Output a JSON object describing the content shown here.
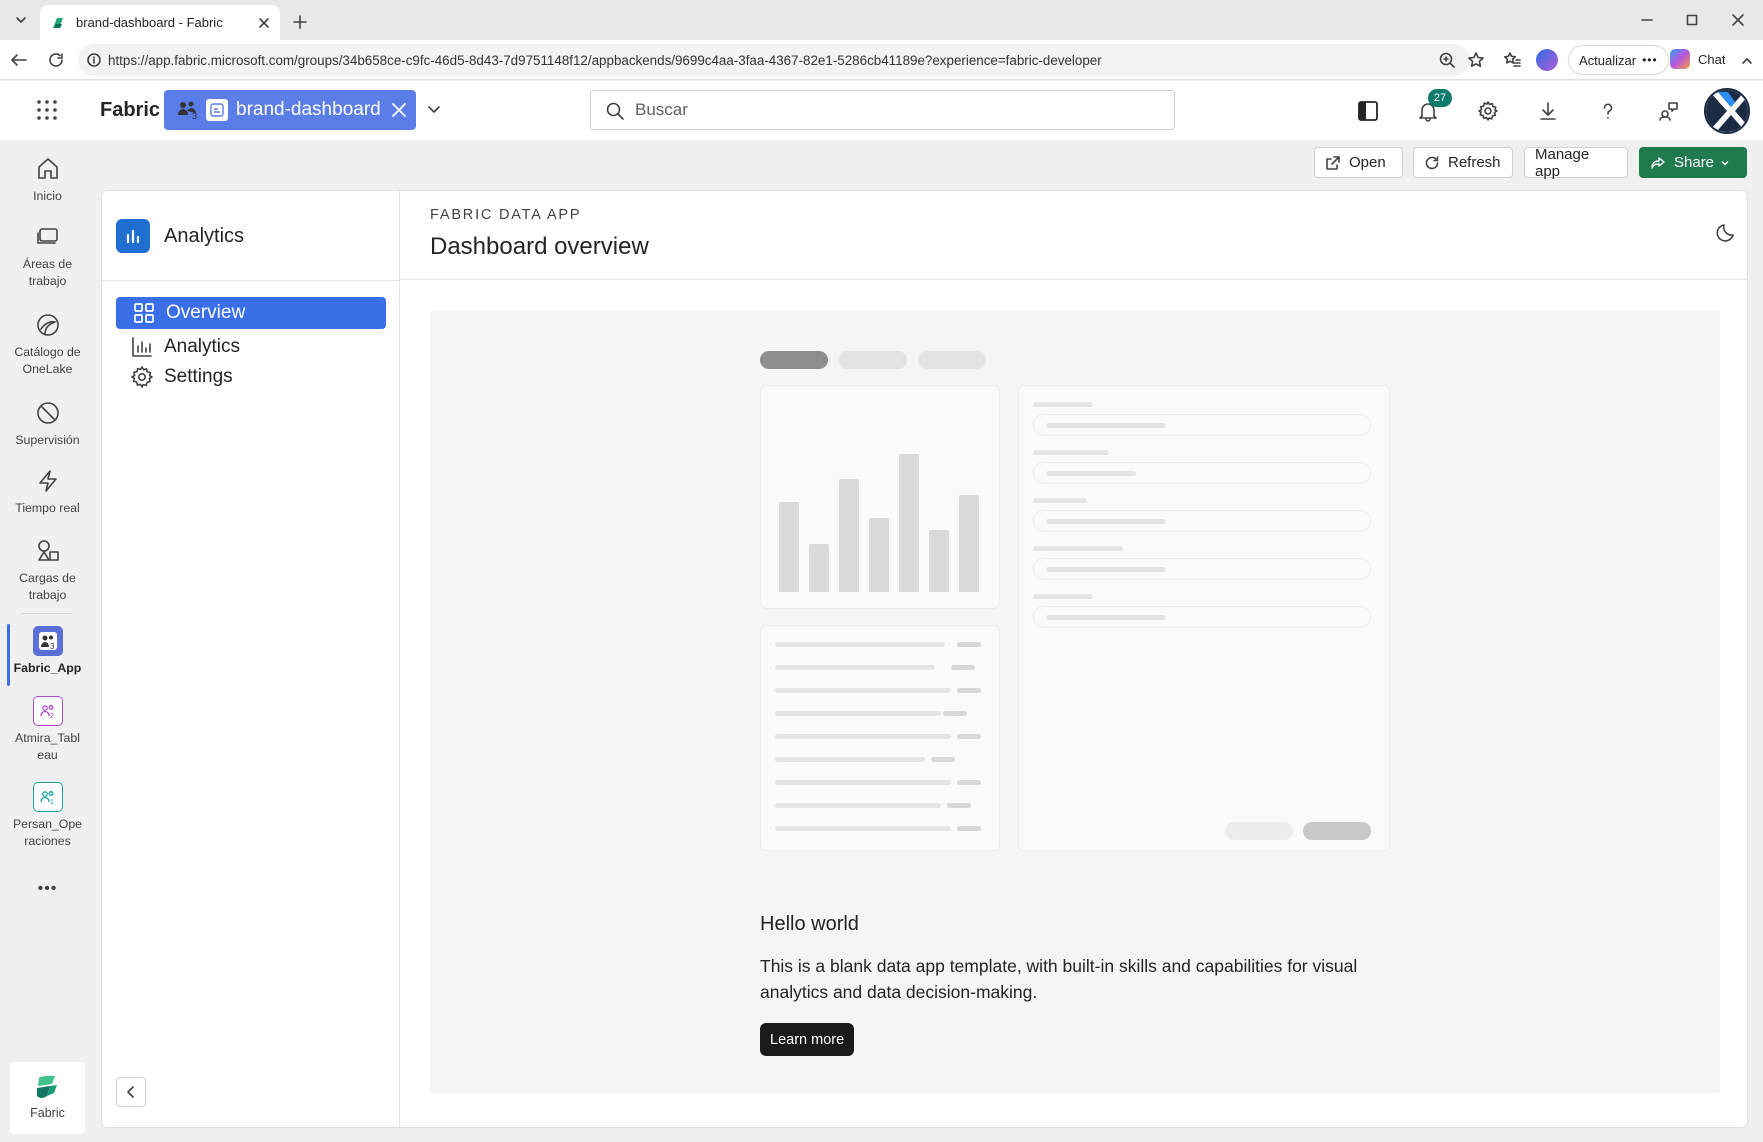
{
  "browser": {
    "tab_title": "brand-dashboard - Fabric",
    "url": "https://app.fabric.microsoft.com/groups/34b658ce-c9fc-46d5-8d43-7d9751148f12/appbackends/9699c4aa-3faa-4367-82e1-5286cb41189e?experience=fabric-developer",
    "update_label": "Actualizar",
    "chat_label": "Chat"
  },
  "header": {
    "brand": "Fabric",
    "app_chip_label": "brand-dashboard",
    "search_placeholder": "Buscar",
    "notification_count": "27"
  },
  "rail": {
    "items": [
      {
        "label": "Inicio"
      },
      {
        "label": "Áreas de trabajo"
      },
      {
        "label": "Catálogo de OneLake"
      },
      {
        "label": "Supervisión"
      },
      {
        "label": "Tiempo real"
      },
      {
        "label": "Cargas de trabajo"
      },
      {
        "label": "Fabric_App"
      },
      {
        "label": "Atmira_Tableau"
      },
      {
        "label": "Persan_Operaciones"
      }
    ],
    "more": "•••",
    "bottom_label": "Fabric"
  },
  "actions": {
    "open": "Open",
    "refresh": "Refresh",
    "manage": "Manage app",
    "share": "Share"
  },
  "app": {
    "name": "Analytics",
    "nav": [
      {
        "label": "Overview",
        "active": true
      },
      {
        "label": "Analytics"
      },
      {
        "label": "Settings"
      }
    ],
    "eyebrow": "FABRIC DATA APP",
    "page_title": "Dashboard overview",
    "hero_title": "Hello world",
    "hero_text_1": "This is a blank data app template, with built-in skills and capabilities for visual",
    "hero_text_2": "analytics and data decision-making.",
    "learn_more": "Learn more"
  },
  "colors": {
    "accent": "#3b6fe8",
    "share_green": "#1f7a4d",
    "chip_blue": "#5b7de8",
    "badge_teal": "#0f7b6c"
  }
}
